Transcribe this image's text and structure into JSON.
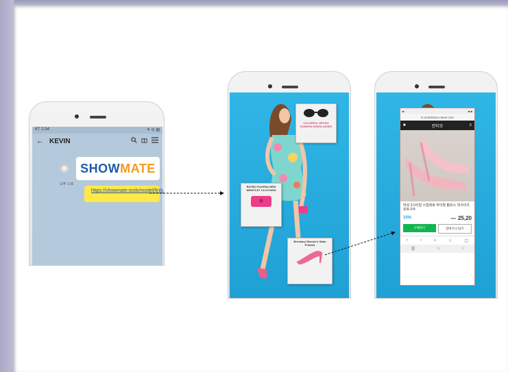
{
  "chat": {
    "status_left": "KT 2:34",
    "status_right": "✳ ⊙ ▤",
    "back_icon": "←",
    "title": "KEVIN",
    "brand_show": "SHOW",
    "brand_mate": "MATE",
    "timestamp": "오후 1:36",
    "link_text": "https://showmate.tools/model/finls.html"
  },
  "tags": {
    "sunglasses": "COLORFUL RETRO FASHION SUNGLASSES",
    "clutch": "RATEN FUCHSIA NEW WRISTLET CLUTCHES",
    "shoes": "Brookary Women's Sabo Pointed"
  },
  "shop": {
    "url": "m.smartstore.naver.com",
    "store_name": "칸티모",
    "product_title": "여성 2스타일 스틸레토 하이힐 펌프스 빅사이즈 보트구두",
    "discount": "10%",
    "price": "25,20",
    "buy_label": "구매하기",
    "cart_label": "장바구니 담기"
  },
  "colors": {
    "brand_blue": "#1d5aa8",
    "brand_orange": "#f39a1d",
    "link_highlight": "#ffe94a",
    "buy_green": "#12b54f",
    "discount_blue": "#28a7e5",
    "photo_backdrop": "#2fb6e6"
  }
}
